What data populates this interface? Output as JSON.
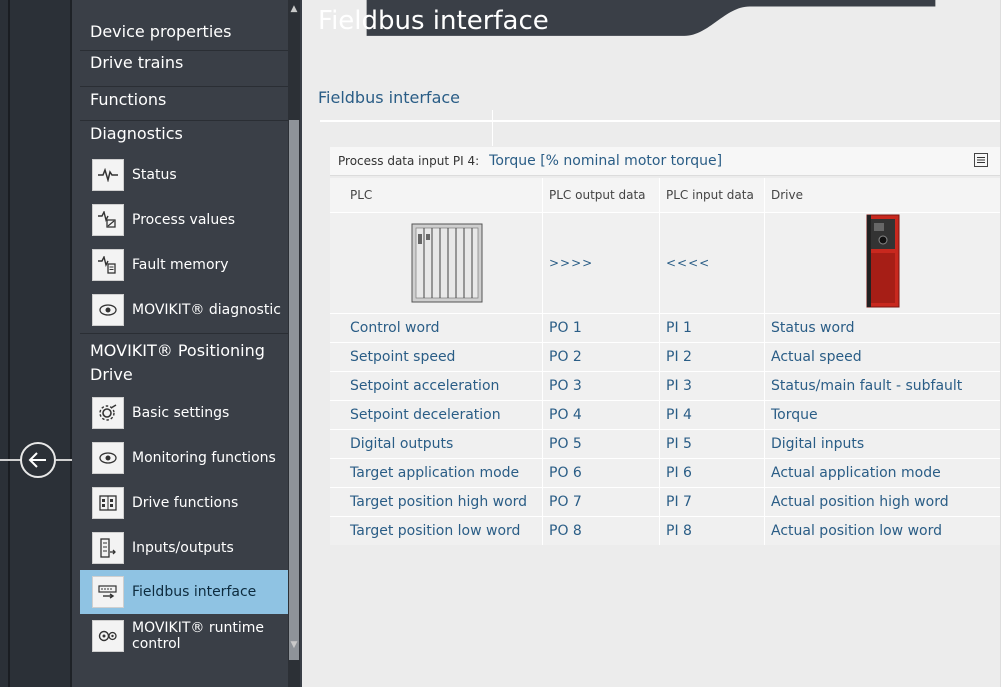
{
  "sidebar": {
    "sections": [
      {
        "label": "Device properties"
      },
      {
        "label": "Drive trains"
      },
      {
        "label": "Functions"
      },
      {
        "label": "Diagnostics"
      }
    ],
    "diagnostics_items": [
      {
        "label": "Status",
        "icon": "pulse-icon"
      },
      {
        "label": "Process values",
        "icon": "process-values-icon"
      },
      {
        "label": "Fault memory",
        "icon": "fault-memory-icon"
      },
      {
        "label": "MOVIKIT® diagnostic",
        "icon": "eye-icon"
      }
    ],
    "positioning_section": {
      "label": "MOVIKIT® Positioning Drive"
    },
    "positioning_items": [
      {
        "label": "Basic settings",
        "icon": "settings-icon"
      },
      {
        "label": "Monitoring functions",
        "icon": "eye-icon"
      },
      {
        "label": "Drive functions",
        "icon": "drive-functions-icon"
      },
      {
        "label": "Inputs/outputs",
        "icon": "io-icon"
      },
      {
        "label": "Fieldbus interface",
        "icon": "fieldbus-icon",
        "active": true
      },
      {
        "label": "MOVIKIT® runtime control",
        "icon": "runtime-control-icon"
      }
    ]
  },
  "main": {
    "page_title": "Fieldbus interface",
    "section_title": "Fieldbus interface",
    "process_data": {
      "label": "Process data input PI 4:",
      "value": "Torque [% nominal motor torque]"
    },
    "table": {
      "headers": [
        "PLC",
        "PLC output data",
        "PLC input data",
        "Drive"
      ],
      "arrows_out": ">>>>",
      "arrows_in": "<<<<",
      "rows": [
        {
          "plc": "Control word",
          "out": "PO 1",
          "in": "PI 1",
          "drive": "Status word"
        },
        {
          "plc": "Setpoint speed",
          "out": "PO 2",
          "in": "PI 2",
          "drive": "Actual speed"
        },
        {
          "plc": "Setpoint acceleration",
          "out": "PO 3",
          "in": "PI 3",
          "drive": "Status/main fault - subfault"
        },
        {
          "plc": "Setpoint deceleration",
          "out": "PO 4",
          "in": "PI 4",
          "drive": "Torque"
        },
        {
          "plc": "Digital outputs",
          "out": "PO 5",
          "in": "PI 5",
          "drive": "Digital inputs"
        },
        {
          "plc": "Target application mode",
          "out": "PO 6",
          "in": "PI 6",
          "drive": "Actual application mode"
        },
        {
          "plc": "Target position high word",
          "out": "PO 7",
          "in": "PI 7",
          "drive": "Actual position high word"
        },
        {
          "plc": "Target position low word",
          "out": "PO 8",
          "in": "PI 8",
          "drive": "Actual position low word"
        }
      ]
    }
  },
  "colors": {
    "accent_text": "#2a5d86",
    "active_item": "#8fc3e3",
    "sidebar_bg": "#3a3f47",
    "drive_red": "#c8281e"
  }
}
